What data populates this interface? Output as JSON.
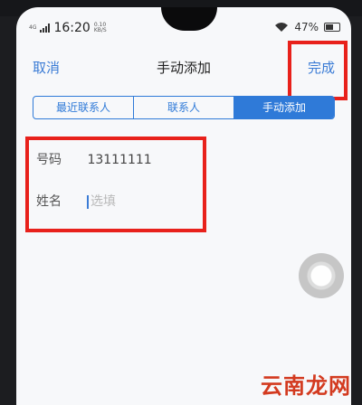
{
  "status_bar": {
    "network": "4G",
    "time": "16:20",
    "speed_value": "0.10",
    "speed_unit": "KB/S",
    "battery": "47%"
  },
  "nav": {
    "cancel": "取消",
    "title": "手动添加",
    "done": "完成"
  },
  "tabs": [
    {
      "label": "最近联系人",
      "active": false
    },
    {
      "label": "联系人",
      "active": false
    },
    {
      "label": "手动添加",
      "active": true
    }
  ],
  "form": {
    "number_label": "号码",
    "number_value": "13111111",
    "name_label": "姓名",
    "name_placeholder": "选填"
  },
  "watermark": "云南龙网",
  "colors": {
    "accent": "#2f7ad8",
    "highlight": "#e8211b",
    "watermark": "#d33a1f"
  },
  "icons": [
    "signal-icon",
    "wifi-icon",
    "battery-icon",
    "assistive-touch-icon"
  ]
}
